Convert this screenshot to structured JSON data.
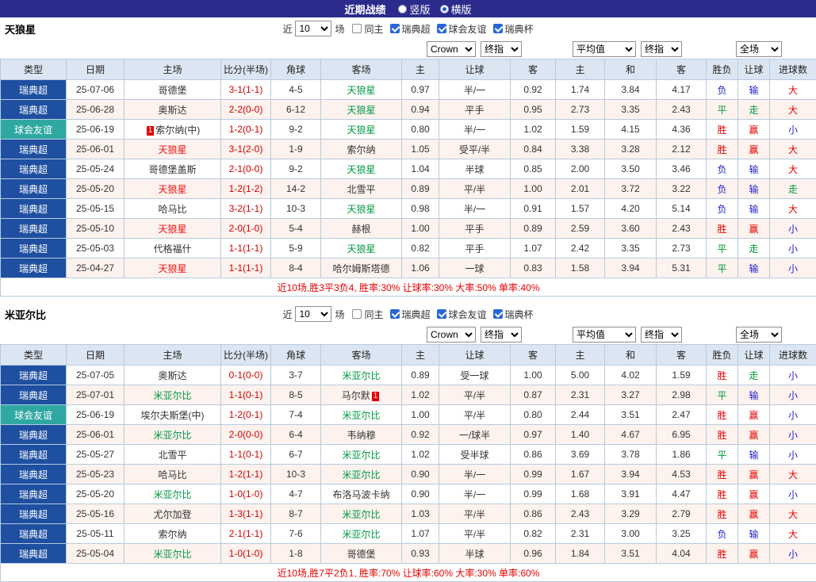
{
  "topbar": {
    "title": "近期战绩",
    "radios": [
      {
        "label": "竖版",
        "selected": false
      },
      {
        "label": "横版",
        "selected": true
      }
    ]
  },
  "table_headers": [
    "类型",
    "日期",
    "主场",
    "比分(半场)",
    "角球",
    "客场",
    "主",
    "让球",
    "客",
    "主",
    "和",
    "客",
    "胜负",
    "让球",
    "进球数"
  ],
  "colors": {
    "topbar_bg": "#2b2b8c",
    "league_badge_bg": "#1e4fa1",
    "friendly_badge_bg": "#2fa8a2",
    "header_bg": "#dce6f2",
    "alt_row_bg": "#fdf2ed",
    "win_red": "#e60000",
    "draw_green": "#009933",
    "loss_blue": "#2020d0",
    "score_red": "#d00000",
    "team_home_red": "#ee1111",
    "team_away_green": "#009944"
  },
  "sections": [
    {
      "team": "天狼星",
      "filter": {
        "near": "近",
        "count": "10",
        "games": "场",
        "checkboxes": [
          {
            "label": "同主",
            "checked": false
          },
          {
            "label": "瑞典超",
            "checked": true
          },
          {
            "label": "球会友谊",
            "checked": true
          },
          {
            "label": "瑞典杯",
            "checked": true
          }
        ]
      },
      "selects": {
        "book": "Crown",
        "book_period": "终指",
        "avg": "平均值",
        "avg_period": "终指",
        "scope": "全场"
      },
      "rows": [
        {
          "type": {
            "t": "瑞典超",
            "c": "league"
          },
          "date": "25-07-06",
          "home": {
            "t": "哥德堡",
            "c": ""
          },
          "score": "3-1(1-1)",
          "corner": "4-5",
          "away": {
            "t": "天狼星",
            "c": "green"
          },
          "odds": [
            "0.97",
            "半/一",
            "0.92"
          ],
          "avg": [
            "1.74",
            "3.84",
            "4.17"
          ],
          "res": [
            {
              "t": "负",
              "c": "blue"
            },
            {
              "t": "输",
              "c": "blue"
            },
            {
              "t": "大",
              "c": "red"
            }
          ]
        },
        {
          "type": {
            "t": "瑞典超",
            "c": "league"
          },
          "date": "25-06-28",
          "home": {
            "t": "奥斯达",
            "c": ""
          },
          "score": "2-2(0-0)",
          "corner": "6-12",
          "away": {
            "t": "天狼星",
            "c": "green"
          },
          "odds": [
            "0.94",
            "平手",
            "0.95"
          ],
          "avg": [
            "2.73",
            "3.35",
            "2.43"
          ],
          "res": [
            {
              "t": "平",
              "c": "green"
            },
            {
              "t": "走",
              "c": "green"
            },
            {
              "t": "大",
              "c": "red"
            }
          ]
        },
        {
          "type": {
            "t": "球会友谊",
            "c": "friendly"
          },
          "date": "25-06-19",
          "home": {
            "t": "索尔纳(中)",
            "c": "",
            "card": "1",
            "card_pos": "before"
          },
          "score": "1-2(0-1)",
          "corner": "9-2",
          "away": {
            "t": "天狼星",
            "c": "green"
          },
          "odds": [
            "0.80",
            "半/一",
            "1.02"
          ],
          "avg": [
            "1.59",
            "4.15",
            "4.36"
          ],
          "res": [
            {
              "t": "胜",
              "c": "red"
            },
            {
              "t": "赢",
              "c": "red"
            },
            {
              "t": "小",
              "c": "blue"
            }
          ]
        },
        {
          "type": {
            "t": "瑞典超",
            "c": "league"
          },
          "date": "25-06-01",
          "home": {
            "t": "天狼星",
            "c": "red"
          },
          "score": "3-1(2-0)",
          "corner": "1-9",
          "away": {
            "t": "索尔纳",
            "c": ""
          },
          "odds": [
            "1.05",
            "受平/半",
            "0.84"
          ],
          "avg": [
            "3.38",
            "3.28",
            "2.12"
          ],
          "res": [
            {
              "t": "胜",
              "c": "red"
            },
            {
              "t": "赢",
              "c": "red"
            },
            {
              "t": "大",
              "c": "red"
            }
          ]
        },
        {
          "type": {
            "t": "瑞典超",
            "c": "league"
          },
          "date": "25-05-24",
          "home": {
            "t": "哥德堡盖斯",
            "c": ""
          },
          "score": "2-1(0-0)",
          "corner": "9-2",
          "away": {
            "t": "天狼星",
            "c": "green"
          },
          "odds": [
            "1.04",
            "半球",
            "0.85"
          ],
          "avg": [
            "2.00",
            "3.50",
            "3.46"
          ],
          "res": [
            {
              "t": "负",
              "c": "blue"
            },
            {
              "t": "输",
              "c": "blue"
            },
            {
              "t": "大",
              "c": "red"
            }
          ]
        },
        {
          "type": {
            "t": "瑞典超",
            "c": "league"
          },
          "date": "25-05-20",
          "home": {
            "t": "天狼星",
            "c": "red"
          },
          "score": "1-2(1-2)",
          "corner": "14-2",
          "away": {
            "t": "北雪平",
            "c": ""
          },
          "odds": [
            "0.89",
            "平/半",
            "1.00"
          ],
          "avg": [
            "2.01",
            "3.72",
            "3.22"
          ],
          "res": [
            {
              "t": "负",
              "c": "blue"
            },
            {
              "t": "输",
              "c": "blue"
            },
            {
              "t": "走",
              "c": "green"
            }
          ]
        },
        {
          "type": {
            "t": "瑞典超",
            "c": "league"
          },
          "date": "25-05-15",
          "home": {
            "t": "哈马比",
            "c": ""
          },
          "score": "3-2(1-1)",
          "corner": "10-3",
          "away": {
            "t": "天狼星",
            "c": "green"
          },
          "odds": [
            "0.98",
            "半/一",
            "0.91"
          ],
          "avg": [
            "1.57",
            "4.20",
            "5.14"
          ],
          "res": [
            {
              "t": "负",
              "c": "blue"
            },
            {
              "t": "输",
              "c": "blue"
            },
            {
              "t": "大",
              "c": "red"
            }
          ]
        },
        {
          "type": {
            "t": "瑞典超",
            "c": "league"
          },
          "date": "25-05-10",
          "home": {
            "t": "天狼星",
            "c": "red"
          },
          "score": "2-0(1-0)",
          "corner": "5-4",
          "away": {
            "t": "赫根",
            "c": ""
          },
          "odds": [
            "1.00",
            "平手",
            "0.89"
          ],
          "avg": [
            "2.59",
            "3.60",
            "2.43"
          ],
          "res": [
            {
              "t": "胜",
              "c": "red"
            },
            {
              "t": "赢",
              "c": "red"
            },
            {
              "t": "小",
              "c": "blue"
            }
          ]
        },
        {
          "type": {
            "t": "瑞典超",
            "c": "league"
          },
          "date": "25-05-03",
          "home": {
            "t": "代格福什",
            "c": ""
          },
          "score": "1-1(1-1)",
          "corner": "5-9",
          "away": {
            "t": "天狼星",
            "c": "green"
          },
          "odds": [
            "0.82",
            "平手",
            "1.07"
          ],
          "avg": [
            "2.42",
            "3.35",
            "2.73"
          ],
          "res": [
            {
              "t": "平",
              "c": "green"
            },
            {
              "t": "走",
              "c": "green"
            },
            {
              "t": "小",
              "c": "blue"
            }
          ]
        },
        {
          "type": {
            "t": "瑞典超",
            "c": "league"
          },
          "date": "25-04-27",
          "home": {
            "t": "天狼星",
            "c": "red"
          },
          "score": "1-1(1-1)",
          "corner": "8-4",
          "away": {
            "t": "哈尔姆斯塔德",
            "c": ""
          },
          "odds": [
            "1.06",
            "一球",
            "0.83"
          ],
          "avg": [
            "1.58",
            "3.94",
            "5.31"
          ],
          "res": [
            {
              "t": "平",
              "c": "green"
            },
            {
              "t": "输",
              "c": "blue"
            },
            {
              "t": "小",
              "c": "blue"
            }
          ]
        }
      ],
      "summary": "近10场,胜3平3负4, 胜率:30% 让球率:30% 大率:50% 单率:40%"
    },
    {
      "team": "米亚尔比",
      "filter": {
        "near": "近",
        "count": "10",
        "games": "场",
        "checkboxes": [
          {
            "label": "同主",
            "checked": false
          },
          {
            "label": "瑞典超",
            "checked": true
          },
          {
            "label": "球会友谊",
            "checked": true
          },
          {
            "label": "瑞典杯",
            "checked": true
          }
        ]
      },
      "selects": {
        "book": "Crown",
        "book_period": "终指",
        "avg": "平均值",
        "avg_period": "终指",
        "scope": "全场"
      },
      "rows": [
        {
          "type": {
            "t": "瑞典超",
            "c": "league"
          },
          "date": "25-07-05",
          "home": {
            "t": "奥斯达",
            "c": ""
          },
          "score": "0-1(0-0)",
          "corner": "3-7",
          "away": {
            "t": "米亚尔比",
            "c": "green"
          },
          "odds": [
            "0.89",
            "受一球",
            "1.00"
          ],
          "avg": [
            "5.00",
            "4.02",
            "1.59"
          ],
          "res": [
            {
              "t": "胜",
              "c": "red"
            },
            {
              "t": "走",
              "c": "green"
            },
            {
              "t": "小",
              "c": "blue"
            }
          ]
        },
        {
          "type": {
            "t": "瑞典超",
            "c": "league"
          },
          "date": "25-07-01",
          "home": {
            "t": "米亚尔比",
            "c": "green"
          },
          "score": "1-1(0-1)",
          "corner": "8-5",
          "away": {
            "t": "马尔默",
            "c": "",
            "card": "1",
            "card_pos": "after"
          },
          "odds": [
            "1.02",
            "平/半",
            "0.87"
          ],
          "avg": [
            "2.31",
            "3.27",
            "2.98"
          ],
          "res": [
            {
              "t": "平",
              "c": "green"
            },
            {
              "t": "输",
              "c": "blue"
            },
            {
              "t": "小",
              "c": "blue"
            }
          ]
        },
        {
          "type": {
            "t": "球会友谊",
            "c": "friendly"
          },
          "date": "25-06-19",
          "home": {
            "t": "埃尔夫斯堡(中)",
            "c": ""
          },
          "score": "1-2(0-1)",
          "corner": "7-4",
          "away": {
            "t": "米亚尔比",
            "c": "green"
          },
          "odds": [
            "1.00",
            "平/半",
            "0.80"
          ],
          "avg": [
            "2.44",
            "3.51",
            "2.47"
          ],
          "res": [
            {
              "t": "胜",
              "c": "red"
            },
            {
              "t": "赢",
              "c": "red"
            },
            {
              "t": "小",
              "c": "blue"
            }
          ]
        },
        {
          "type": {
            "t": "瑞典超",
            "c": "league"
          },
          "date": "25-06-01",
          "home": {
            "t": "米亚尔比",
            "c": "green"
          },
          "score": "2-0(0-0)",
          "corner": "6-4",
          "away": {
            "t": "韦纳穆",
            "c": ""
          },
          "odds": [
            "0.92",
            "一/球半",
            "0.97"
          ],
          "avg": [
            "1.40",
            "4.67",
            "6.95"
          ],
          "res": [
            {
              "t": "胜",
              "c": "red"
            },
            {
              "t": "赢",
              "c": "red"
            },
            {
              "t": "小",
              "c": "blue"
            }
          ]
        },
        {
          "type": {
            "t": "瑞典超",
            "c": "league"
          },
          "date": "25-05-27",
          "home": {
            "t": "北雪平",
            "c": ""
          },
          "score": "1-1(0-1)",
          "corner": "6-7",
          "away": {
            "t": "米亚尔比",
            "c": "green"
          },
          "odds": [
            "1.02",
            "受半球",
            "0.86"
          ],
          "avg": [
            "3.69",
            "3.78",
            "1.86"
          ],
          "res": [
            {
              "t": "平",
              "c": "green"
            },
            {
              "t": "输",
              "c": "blue"
            },
            {
              "t": "小",
              "c": "blue"
            }
          ]
        },
        {
          "type": {
            "t": "瑞典超",
            "c": "league"
          },
          "date": "25-05-23",
          "home": {
            "t": "哈马比",
            "c": ""
          },
          "score": "1-2(1-1)",
          "corner": "10-3",
          "away": {
            "t": "米亚尔比",
            "c": "green"
          },
          "odds": [
            "0.90",
            "半/一",
            "0.99"
          ],
          "avg": [
            "1.67",
            "3.94",
            "4.53"
          ],
          "res": [
            {
              "t": "胜",
              "c": "red"
            },
            {
              "t": "赢",
              "c": "red"
            },
            {
              "t": "大",
              "c": "red"
            }
          ]
        },
        {
          "type": {
            "t": "瑞典超",
            "c": "league"
          },
          "date": "25-05-20",
          "home": {
            "t": "米亚尔比",
            "c": "green"
          },
          "score": "1-0(1-0)",
          "corner": "4-7",
          "away": {
            "t": "布洛马波卡纳",
            "c": ""
          },
          "odds": [
            "0.90",
            "半/一",
            "0.99"
          ],
          "avg": [
            "1.68",
            "3.91",
            "4.47"
          ],
          "res": [
            {
              "t": "胜",
              "c": "red"
            },
            {
              "t": "赢",
              "c": "red"
            },
            {
              "t": "小",
              "c": "blue"
            }
          ]
        },
        {
          "type": {
            "t": "瑞典超",
            "c": "league"
          },
          "date": "25-05-16",
          "home": {
            "t": "尤尔加登",
            "c": ""
          },
          "score": "1-3(1-1)",
          "corner": "8-7",
          "away": {
            "t": "米亚尔比",
            "c": "green"
          },
          "odds": [
            "1.03",
            "平/半",
            "0.86"
          ],
          "avg": [
            "2.43",
            "3.29",
            "2.79"
          ],
          "res": [
            {
              "t": "胜",
              "c": "red"
            },
            {
              "t": "赢",
              "c": "red"
            },
            {
              "t": "大",
              "c": "red"
            }
          ]
        },
        {
          "type": {
            "t": "瑞典超",
            "c": "league"
          },
          "date": "25-05-11",
          "home": {
            "t": "索尔纳",
            "c": ""
          },
          "score": "2-1(1-1)",
          "corner": "7-6",
          "away": {
            "t": "米亚尔比",
            "c": "green"
          },
          "odds": [
            "1.07",
            "平/半",
            "0.82"
          ],
          "avg": [
            "2.31",
            "3.00",
            "3.25"
          ],
          "res": [
            {
              "t": "负",
              "c": "blue"
            },
            {
              "t": "输",
              "c": "blue"
            },
            {
              "t": "大",
              "c": "red"
            }
          ]
        },
        {
          "type": {
            "t": "瑞典超",
            "c": "league"
          },
          "date": "25-05-04",
          "home": {
            "t": "米亚尔比",
            "c": "green"
          },
          "score": "1-0(1-0)",
          "corner": "1-8",
          "away": {
            "t": "哥德堡",
            "c": ""
          },
          "odds": [
            "0.93",
            "半球",
            "0.96"
          ],
          "avg": [
            "1.84",
            "3.51",
            "4.04"
          ],
          "res": [
            {
              "t": "胜",
              "c": "red"
            },
            {
              "t": "赢",
              "c": "red"
            },
            {
              "t": "小",
              "c": "blue"
            }
          ]
        }
      ],
      "summary": "近10场,胜7平2负1, 胜率:70% 让球率:60% 大率:30% 单率:60%"
    }
  ]
}
